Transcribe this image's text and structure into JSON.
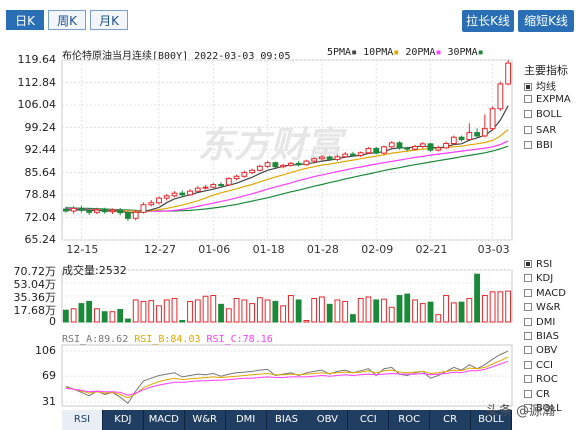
{
  "tabs": [
    {
      "label": "日K",
      "active": true
    },
    {
      "label": "周K",
      "active": false
    },
    {
      "label": "月K",
      "active": false
    }
  ],
  "buttons": {
    "stretch": "拉长K线",
    "shorten": "缩短K线"
  },
  "header": {
    "title": "布伦特原油当月连续[B00Y] 2022-03-03 09:05",
    "ma": [
      {
        "label": "5PMA",
        "color": "#444444"
      },
      {
        "label": "10PMA",
        "color": "#e0a800"
      },
      {
        "label": "20PMA",
        "color": "#ff3cff"
      },
      {
        "label": "30PMA",
        "color": "#1a8a3a"
      }
    ]
  },
  "y_labels": [
    "119.64",
    "112.84",
    "106.04",
    "99.24",
    "92.44",
    "85.64",
    "78.84",
    "72.04",
    "65.24"
  ],
  "x_labels": [
    "12-15",
    "12-27",
    "01-06",
    "01-18",
    "01-28",
    "02-09",
    "02-21",
    "03-03"
  ],
  "volume": {
    "label": "成交量:2532",
    "y_labels": [
      "70.72万",
      "53.04万",
      "35.36万",
      "17.68万",
      "0"
    ]
  },
  "rsi": {
    "legend": [
      {
        "label": "RSI_A:89.62",
        "color": "#777777"
      },
      {
        "label": "RSI_B:84.03",
        "color": "#e0a800"
      },
      {
        "label": "RSI_C:78.16",
        "color": "#ff3cff"
      }
    ],
    "y_labels": [
      "106",
      "69",
      "31"
    ]
  },
  "sidebar": {
    "title": "主要指标",
    "main_items": [
      {
        "label": "均线",
        "checked": true
      },
      {
        "label": "EXPMA",
        "checked": false
      },
      {
        "label": "BOLL",
        "checked": false
      },
      {
        "label": "SAR",
        "checked": false
      },
      {
        "label": "BBI",
        "checked": false
      }
    ],
    "sub_items": [
      {
        "label": "RSI",
        "checked": true
      },
      {
        "label": "KDJ",
        "checked": false
      },
      {
        "label": "MACD",
        "checked": false
      },
      {
        "label": "W&R",
        "checked": false
      },
      {
        "label": "DMI",
        "checked": false
      },
      {
        "label": "BIAS",
        "checked": false
      },
      {
        "label": "OBV",
        "checked": false
      },
      {
        "label": "CCI",
        "checked": false
      },
      {
        "label": "ROC",
        "checked": false
      },
      {
        "label": "CR",
        "checked": false
      },
      {
        "label": "BOLL",
        "checked": false
      }
    ]
  },
  "bottom_tabs": [
    "RSI",
    "KDJ",
    "MACD",
    "W&R",
    "DMI",
    "BIAS",
    "OBV",
    "CCI",
    "ROC",
    "CR",
    "BOLL"
  ],
  "watermark": "东方财富",
  "attribution": "头条 @源瀚",
  "chart_data": {
    "type": "candlestick",
    "title": "布伦特原油当月连续[B00Y] 2022-03-03 09:05",
    "ylim": [
      65.24,
      119.64
    ],
    "x_ticks": [
      "12-15",
      "12-27",
      "01-06",
      "01-18",
      "01-28",
      "02-09",
      "02-21",
      "03-03"
    ],
    "candles": [
      [
        74.6,
        74.0,
        75.3,
        73.5
      ],
      [
        74.0,
        74.8,
        75.5,
        73.2
      ],
      [
        74.8,
        74.2,
        75.6,
        73.6
      ],
      [
        74.2,
        73.6,
        74.9,
        72.8
      ],
      [
        73.6,
        74.3,
        75.0,
        73.1
      ],
      [
        74.3,
        73.8,
        75.0,
        73.2
      ],
      [
        73.8,
        74.2,
        74.8,
        73.1
      ],
      [
        74.2,
        73.5,
        74.9,
        72.7
      ],
      [
        73.5,
        71.8,
        74.0,
        71.0
      ],
      [
        71.8,
        73.6,
        74.2,
        71.2
      ],
      [
        73.6,
        75.9,
        76.6,
        73.2
      ],
      [
        75.9,
        76.5,
        77.3,
        75.4
      ],
      [
        76.5,
        77.9,
        78.4,
        76.0
      ],
      [
        77.9,
        78.6,
        79.1,
        77.2
      ],
      [
        78.6,
        79.4,
        80.0,
        78.2
      ],
      [
        79.4,
        78.9,
        80.2,
        78.4
      ],
      [
        78.9,
        80.0,
        80.6,
        78.6
      ],
      [
        80.0,
        80.9,
        81.5,
        79.7
      ],
      [
        80.9,
        81.2,
        81.8,
        80.5
      ],
      [
        81.2,
        82.0,
        82.5,
        80.9
      ],
      [
        82.0,
        81.9,
        82.7,
        81.3
      ],
      [
        81.9,
        83.8,
        84.2,
        81.6
      ],
      [
        83.8,
        84.5,
        85.0,
        83.3
      ],
      [
        84.5,
        85.6,
        86.2,
        84.1
      ],
      [
        85.6,
        86.3,
        86.8,
        85.1
      ],
      [
        86.3,
        87.5,
        88.0,
        86.0
      ],
      [
        87.5,
        88.6,
        89.1,
        87.0
      ],
      [
        88.6,
        87.4,
        89.0,
        87.0
      ],
      [
        87.4,
        87.8,
        88.3,
        86.9
      ],
      [
        87.8,
        88.4,
        88.9,
        87.4
      ],
      [
        88.4,
        88.0,
        89.1,
        87.5
      ],
      [
        88.0,
        89.1,
        89.5,
        87.7
      ],
      [
        89.1,
        89.8,
        90.2,
        88.6
      ],
      [
        89.8,
        90.3,
        90.9,
        89.3
      ],
      [
        90.3,
        89.6,
        90.8,
        89.2
      ],
      [
        89.6,
        90.4,
        91.0,
        89.1
      ],
      [
        90.4,
        91.2,
        91.8,
        90.0
      ],
      [
        91.2,
        90.8,
        91.9,
        90.4
      ],
      [
        90.8,
        91.6,
        92.0,
        90.3
      ],
      [
        91.6,
        92.9,
        93.3,
        91.2
      ],
      [
        92.9,
        91.5,
        93.4,
        91.1
      ],
      [
        91.5,
        93.4,
        93.8,
        91.0
      ],
      [
        93.4,
        94.6,
        95.1,
        93.0
      ],
      [
        94.6,
        93.0,
        95.1,
        92.6
      ],
      [
        93.0,
        92.7,
        93.4,
        92.1
      ],
      [
        92.7,
        93.5,
        94.0,
        92.3
      ],
      [
        93.5,
        94.3,
        94.8,
        93.0
      ],
      [
        94.3,
        92.4,
        94.6,
        91.9
      ],
      [
        92.4,
        93.1,
        93.7,
        92.0
      ],
      [
        93.1,
        94.4,
        95.0,
        92.8
      ],
      [
        94.4,
        96.3,
        96.8,
        94.0
      ],
      [
        96.3,
        95.6,
        96.8,
        95.0
      ],
      [
        95.6,
        97.7,
        100.5,
        95.2
      ],
      [
        97.7,
        96.7,
        99.0,
        96.0
      ],
      [
        96.7,
        98.9,
        103.2,
        96.2
      ],
      [
        98.9,
        104.9,
        105.6,
        98.4
      ],
      [
        104.9,
        112.4,
        113.1,
        104.3
      ],
      [
        112.4,
        118.7,
        119.6,
        112.0
      ]
    ],
    "ma5": [
      74.3,
      74.3,
      74.4,
      74.2,
      74.2,
      74.1,
      74.0,
      73.9,
      73.5,
      73.5,
      73.8,
      74.4,
      75.1,
      76.5,
      77.7,
      78.3,
      78.9,
      79.6,
      80.1,
      80.6,
      81.2,
      81.8,
      82.4,
      83.3,
      84.2,
      85.3,
      86.3,
      86.9,
      87.5,
      87.9,
      88.0,
      88.3,
      88.6,
      89.1,
      89.4,
      89.8,
      90.3,
      90.6,
      90.8,
      91.4,
      91.6,
      92.0,
      92.8,
      93.1,
      93.1,
      93.4,
      93.7,
      93.3,
      93.1,
      93.4,
      94.1,
      94.3,
      95.4,
      96.1,
      96.9,
      98.5,
      101.5,
      105.8
    ],
    "ma10": [
      74.5,
      74.4,
      74.4,
      74.3,
      74.3,
      74.2,
      74.2,
      74.1,
      74.0,
      73.9,
      73.9,
      74.1,
      74.4,
      74.8,
      75.3,
      75.8,
      76.4,
      77.1,
      77.9,
      78.8,
      79.5,
      80.1,
      80.7,
      81.4,
      82.0,
      82.8,
      83.6,
      84.3,
      84.9,
      85.6,
      86.3,
      86.9,
      87.4,
      87.9,
      88.2,
      88.6,
      89.0,
      89.4,
      89.8,
      90.2,
      90.6,
      91.0,
      91.5,
      91.8,
      92.1,
      92.4,
      92.7,
      92.9,
      93.1,
      93.2,
      93.4,
      93.6,
      94.0,
      94.3,
      94.7,
      95.3,
      96.7,
      98.6
    ],
    "ma20": [
      74.8,
      74.7,
      74.6,
      74.5,
      74.4,
      74.3,
      74.3,
      74.2,
      74.1,
      74.0,
      73.9,
      73.9,
      73.9,
      74.0,
      74.2,
      74.5,
      74.9,
      75.4,
      75.9,
      76.4,
      76.9,
      77.4,
      78.0,
      78.6,
      79.2,
      79.9,
      80.6,
      81.3,
      81.9,
      82.5,
      83.2,
      83.8,
      84.4,
      84.9,
      85.4,
      85.9,
      86.4,
      86.9,
      87.3,
      87.8,
      88.2,
      88.6,
      89.0,
      89.4,
      89.8,
      90.2,
      90.5,
      90.9,
      91.2,
      91.5,
      91.8,
      92.1,
      92.4,
      92.7,
      93.0,
      93.4,
      94.1,
      95.2
    ],
    "ma30": [
      75.0,
      74.9,
      74.8,
      74.8,
      74.7,
      74.6,
      74.5,
      74.4,
      74.3,
      74.2,
      74.1,
      74.1,
      74.0,
      74.0,
      74.0,
      74.1,
      74.2,
      74.4,
      74.6,
      74.9,
      75.2,
      75.6,
      76.0,
      76.5,
      77.0,
      77.5,
      78.0,
      78.6,
      79.2,
      79.8,
      80.3,
      80.9,
      81.5,
      82.0,
      82.6,
      83.1,
      83.7,
      84.2,
      84.7,
      85.2,
      85.7,
      86.2,
      86.7,
      87.1,
      87.6,
      88.0,
      88.4,
      88.8,
      89.2,
      89.6,
      90.0,
      90.4,
      90.8,
      91.2,
      91.6,
      92.1,
      92.8,
      93.6
    ],
    "volume": {
      "ylim": [
        0,
        70.72
      ],
      "values": [
        16,
        18,
        25,
        28,
        18,
        14,
        14,
        17,
        4,
        30,
        28,
        29,
        22,
        30,
        32,
        2,
        28,
        30,
        35,
        36,
        24,
        18,
        32,
        30,
        25,
        33,
        30,
        28,
        22,
        36,
        30,
        2,
        32,
        34,
        24,
        30,
        28,
        10,
        32,
        34,
        30,
        31,
        20,
        36,
        38,
        30,
        25,
        27,
        10,
        36,
        26,
        27,
        32,
        65,
        36,
        41,
        41,
        42
      ]
    },
    "rsi": {
      "ylim": [
        25,
        115
      ],
      "series": [
        {
          "name": "RSI_A",
          "values": [
            54,
            50,
            45,
            40,
            47,
            42,
            45,
            38,
            29,
            47,
            62,
            66,
            70,
            72,
            74,
            68,
            70,
            72,
            71,
            73,
            69,
            72,
            74,
            75,
            76,
            78,
            79,
            70,
            72,
            74,
            70,
            74,
            76,
            78,
            72,
            76,
            78,
            74,
            77,
            80,
            70,
            80,
            82,
            72,
            70,
            74,
            76,
            66,
            70,
            76,
            82,
            78,
            86,
            80,
            86,
            94,
            101,
            106
          ]
        },
        {
          "name": "RSI_B",
          "values": [
            52,
            50,
            47,
            44,
            46,
            44,
            45,
            42,
            37,
            43,
            52,
            57,
            61,
            64,
            66,
            64,
            65,
            66,
            67,
            68,
            67,
            68,
            69,
            70,
            71,
            72,
            73,
            71,
            71,
            72,
            71,
            72,
            73,
            74,
            73,
            74,
            75,
            74,
            75,
            77,
            74,
            77,
            78,
            75,
            74,
            75,
            76,
            73,
            74,
            76,
            78,
            77,
            81,
            80,
            82,
            87,
            92,
            97
          ]
        },
        {
          "name": "RSI_C",
          "values": [
            51,
            50,
            48,
            46,
            47,
            46,
            46,
            45,
            41,
            44,
            49,
            53,
            56,
            58,
            60,
            60,
            61,
            62,
            62,
            63,
            63,
            64,
            65,
            66,
            66,
            67,
            68,
            67,
            67,
            68,
            68,
            68,
            69,
            70,
            69,
            70,
            71,
            70,
            71,
            72,
            71,
            72,
            73,
            72,
            72,
            72,
            73,
            71,
            72,
            73,
            75,
            74,
            77,
            77,
            79,
            83,
            87,
            91
          ]
        }
      ]
    }
  }
}
